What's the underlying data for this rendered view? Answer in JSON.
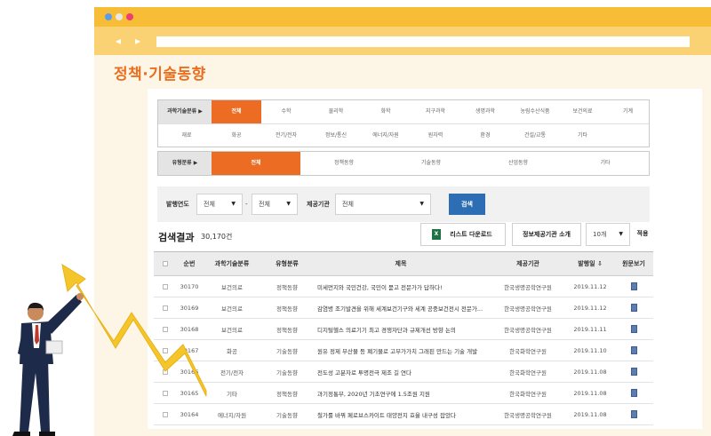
{
  "page_title": "정책·기술동향",
  "filters": {
    "science_tech": {
      "label": "과학기술분류 ▶",
      "row1": [
        "전체",
        "수학",
        "물리학",
        "화학",
        "지구과학",
        "생명과학",
        "농림수산식품",
        "보건의료",
        "기계"
      ],
      "row2": [
        "재료",
        "화공",
        "전기/전자",
        "정보/통신",
        "에너지/자원",
        "원자력",
        "환경",
        "건설/교통",
        "기타"
      ],
      "active": "전체"
    },
    "type": {
      "label": "유형분류 ▶",
      "items": [
        "전체",
        "정책동향",
        "기술동향",
        "산업동향",
        "기타"
      ],
      "active": "전체"
    }
  },
  "search": {
    "year_label": "발행연도",
    "year_from": "전체",
    "dash": "-",
    "year_to": "전체",
    "org_label": "제공기관",
    "org_value": "전체",
    "button": "검색"
  },
  "results": {
    "title": "검색결과",
    "count": "30,170건",
    "excel_button": "리스트 다운로드",
    "excel_icon_letter": "X",
    "org_intro_button": "정보제공기관 소개",
    "page_size": "10개",
    "apply_button": "적용"
  },
  "table": {
    "headers": [
      "",
      "순번",
      "과학기술분류",
      "유형분류",
      "제목",
      "제공기관",
      "발행일 ⇩",
      "원문보기"
    ],
    "rows": [
      [
        "30170",
        "보건의료",
        "정책동향",
        "미세먼지와 국민건강, 국민이 묻고 전문가가 답하다!",
        "한국생명공학연구원",
        "2019.11.12"
      ],
      [
        "30169",
        "보건의료",
        "정책동향",
        "감염병 조기발견을 위해 세계보건기구와 세계 공중보건전시 전문가...",
        "한국생명공학연구원",
        "2019.11.12"
      ],
      [
        "30168",
        "보건의료",
        "정책동향",
        "디지털헬스 의료기기 최고 경쟁자단과 규제개선 방향 논의",
        "한국생명공학연구원",
        "2019.11.11"
      ],
      [
        "30167",
        "화공",
        "기술동향",
        "원유 정제 부산물 등 폐기물로 고부가가치 그래핀 만드는 기술 개발",
        "한국화학연구원",
        "2019.11.10"
      ],
      [
        "30166",
        "전기/전자",
        "기술동향",
        "전도성 고분자로 투명전극 제조 길 연다",
        "한국화학연구원",
        "2019.11.08"
      ],
      [
        "30165",
        "기타",
        "정책동향",
        "과기정통부, 2020년 기초연구에 1.5조원 지원",
        "한국화학연구원",
        "2019.11.08"
      ],
      [
        "30164",
        "에너지/자원",
        "기술동향",
        "철가룰 바꿔 페로브스카이트 태양전지 효율 내구성 잡았다",
        "한국생명공학연구원",
        "2019.11.08"
      ]
    ]
  },
  "colors": {
    "accent_orange": "#eb6c22",
    "title_bar": "#f7bd36",
    "search_blue": "#2d6db3"
  }
}
